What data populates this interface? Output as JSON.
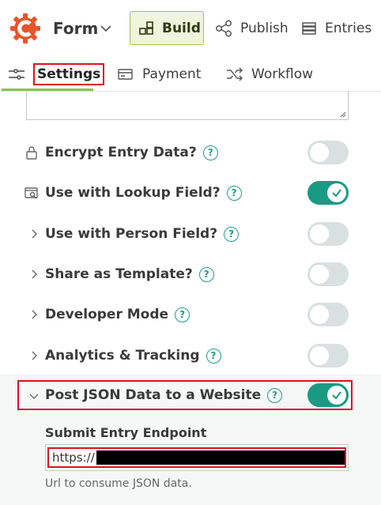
{
  "header": {
    "form_title": "Form",
    "build_label": "Build",
    "publish_label": "Publish",
    "entries_label": "Entries",
    "brand_color": "#e8552a",
    "build_accent": "#9fc25a"
  },
  "tabs": [
    {
      "label": "Settings",
      "active": true
    },
    {
      "label": "Payment",
      "active": false
    },
    {
      "label": "Workflow",
      "active": false
    }
  ],
  "settings": [
    {
      "label": "Encrypt Entry Data?",
      "icon": "lock-icon",
      "enabled": false
    },
    {
      "label": "Use with Lookup Field?",
      "icon": "lookup-icon",
      "enabled": true
    },
    {
      "label": "Use with Person Field?",
      "icon": "chevron-right-icon",
      "enabled": false
    },
    {
      "label": "Share as Template?",
      "icon": "chevron-right-icon",
      "enabled": false
    },
    {
      "label": "Developer Mode",
      "icon": "chevron-right-icon",
      "enabled": false
    },
    {
      "label": "Analytics & Tracking",
      "icon": "chevron-right-icon",
      "enabled": false
    },
    {
      "label": "Post JSON Data to a Website",
      "icon": "chevron-down-icon",
      "enabled": true
    }
  ],
  "endpoint": {
    "label": "Submit Entry Endpoint",
    "value": "https://",
    "help": "Url to consume JSON data."
  },
  "help_glyph": "?",
  "colors": {
    "toggle_on": "#1a9a82",
    "toggle_off": "#d9e0e0",
    "tab_underline": "#8bc34a",
    "highlight": "#d9141d"
  }
}
